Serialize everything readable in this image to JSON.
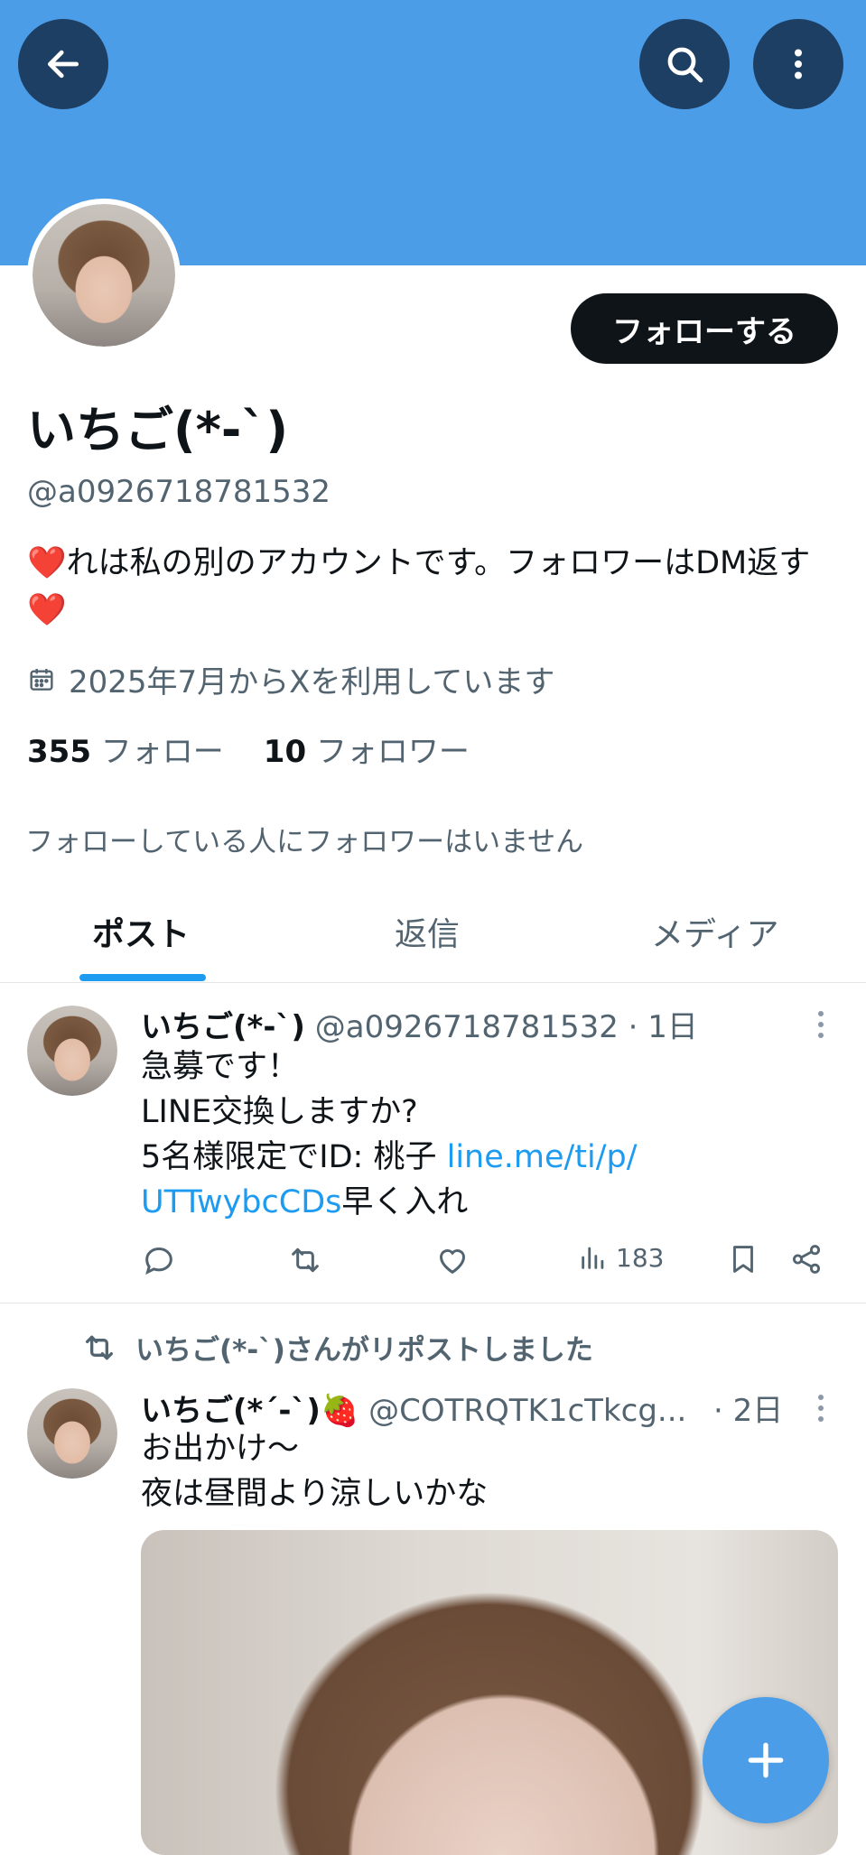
{
  "header": {
    "back_icon": "arrow-left-icon",
    "search_icon": "search-icon",
    "more_icon": "more-vertical-icon",
    "banner_color": "#4c9de8"
  },
  "profile": {
    "name": "いちご(*-`)",
    "handle": "@a0926718781532",
    "follow_label": "フォローする",
    "bio": "❤️れは私の別のアカウントです。フォロワーはDM返す❤️",
    "joined": "2025年7月からXを利用しています",
    "following_count": "355",
    "following_label": "フォロー",
    "followers_count": "10",
    "followers_label": "フォロワー",
    "notice": "フォローしている人にフォロワーはいません"
  },
  "tabs": [
    {
      "label": "ポスト",
      "active": true
    },
    {
      "label": "返信",
      "active": false
    },
    {
      "label": "メディア",
      "active": false
    }
  ],
  "posts": [
    {
      "name": "いちご(*-`)",
      "meta": "@a0926718781532 · 1日",
      "lines": [
        "急募です！",
        "LINE交換しますか?"
      ],
      "line3_prefix": "5名様限定でID:  桃子 ",
      "link_part1": "line.me/ti/p/",
      "link_part2": "UTTwybcCDs",
      "line4_suffix": "早く入れ",
      "views": "183"
    },
    {
      "repost_label": "いちご(*-`)さんがリポストしました",
      "name": "いちご(*´-`)🍓",
      "handle": "@COTRQTK1cTkcg...",
      "time": "· 2日",
      "lines": [
        "お出かけ～",
        "夜は昼間より涼しいかな"
      ]
    }
  ],
  "fab_icon": "plus-icon",
  "accent_color": "#1d9bf0"
}
